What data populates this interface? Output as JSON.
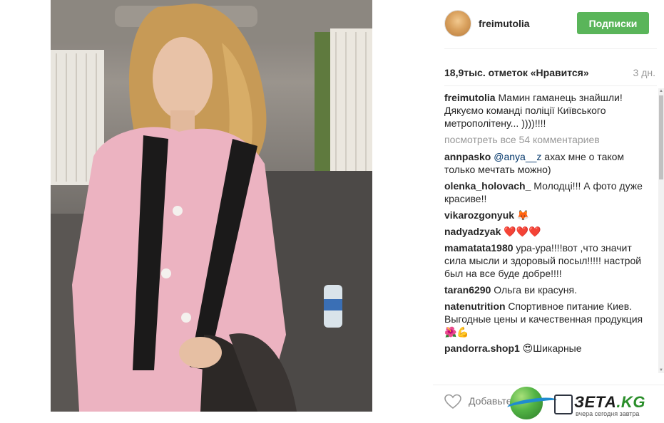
{
  "post": {
    "username": "freimutolia",
    "follow_label": "Подписки",
    "likes": "18,9тыс. отметок «Нравится»",
    "time_ago": "3 дн.",
    "view_all_comments": "посмотреть все 54 комментариев",
    "add_comment_placeholder": "Добавьте",
    "caption": {
      "user": "freimutolia",
      "text": "Мамин гаманець знайшли! Дякуємо команді поліції Київського метрополітену... ))))!!!!"
    },
    "comments": [
      {
        "user": "annpasko",
        "mention": "@anya__z",
        "text": " ахах мне о таком только мечтать можно)"
      },
      {
        "user": "olenka_holovach_",
        "mention": "",
        "text": " Молодці!!! А фото дуже красиве!!"
      },
      {
        "user": "vikarozgonyuk",
        "mention": "",
        "text": " 🦊"
      },
      {
        "user": "nadyadzyak",
        "mention": "",
        "text": " ❤️❤️❤️"
      },
      {
        "user": "mamatata1980",
        "mention": "",
        "text": " ура-ура!!!!вот ,что значит сила мысли и здоровый посыл!!!!! настрой был на все буде добре!!!!"
      },
      {
        "user": "taran6290",
        "mention": "",
        "text": " Ольга ви красуня."
      },
      {
        "user": "natenutrition",
        "mention": "",
        "text": " Спортивное питание Киев. Выгодные цены и качественная продукция 🌺💪"
      },
      {
        "user": "pandorra.shop1",
        "mention": "",
        "text": " 😍Шикарные"
      }
    ]
  },
  "icons": {
    "heart": "heart-outline-icon",
    "scroll_up": "arrow-up-icon",
    "scroll_down": "arrow-down-icon"
  },
  "watermark": {
    "title_main": "ЗЕТА",
    "title_kg": ".KG",
    "subtitle": "вчера сегодня завтра"
  },
  "colors": {
    "follow_button": "#5ab55a",
    "mention": "#003569",
    "muted": "#999999"
  }
}
